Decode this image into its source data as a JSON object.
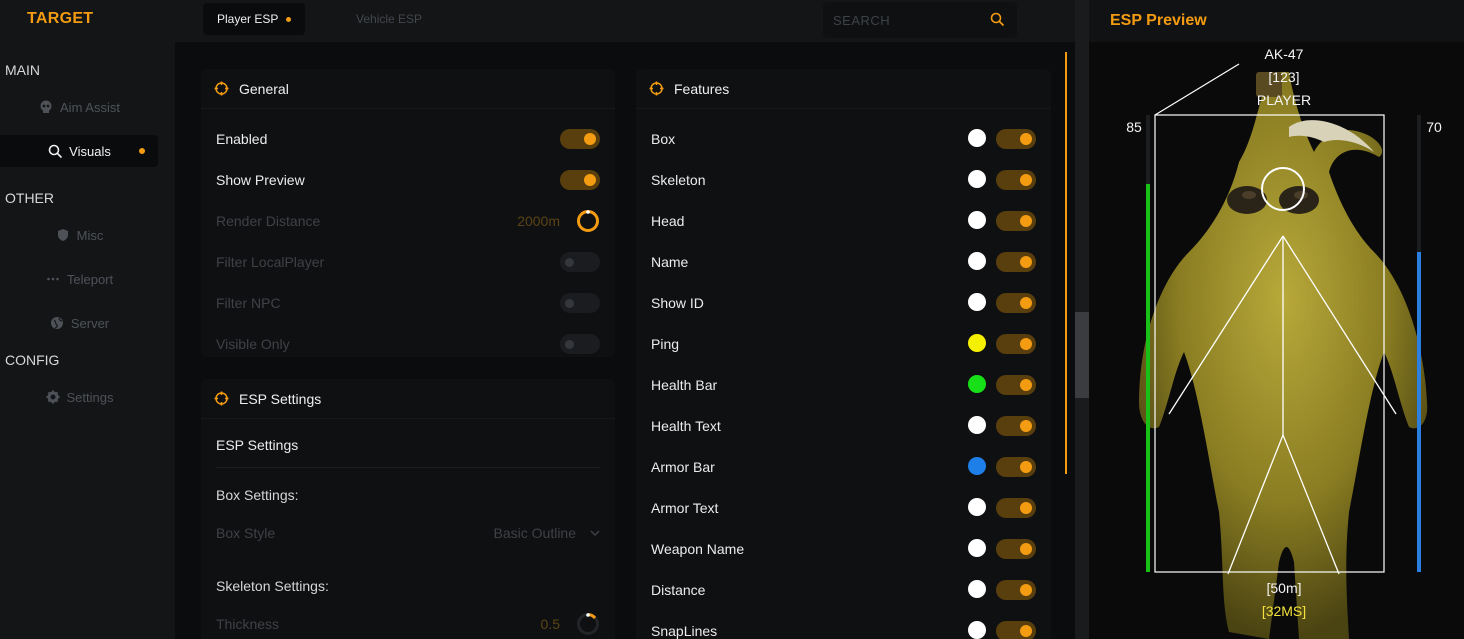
{
  "brand": "TARGET",
  "sidebar": {
    "sections": [
      {
        "title": "MAIN"
      },
      {
        "title": "OTHER"
      },
      {
        "title": "CONFIG"
      }
    ],
    "items": [
      {
        "label": "Aim Assist",
        "icon": "skull-icon"
      },
      {
        "label": "Visuals",
        "icon": "search-icon",
        "active": true
      },
      {
        "label": "Misc",
        "icon": "shield-icon"
      },
      {
        "label": "Teleport",
        "icon": "dots-icon"
      },
      {
        "label": "Server",
        "icon": "globe-icon"
      },
      {
        "label": "Settings",
        "icon": "gear-icon"
      }
    ]
  },
  "tabs": [
    {
      "label": "Player ESP",
      "active": true
    },
    {
      "label": "Vehicle ESP",
      "active": false
    }
  ],
  "search": {
    "placeholder": "SEARCH"
  },
  "general": {
    "title": "General",
    "rows": [
      {
        "label": "Enabled",
        "on": true
      },
      {
        "label": "Show Preview",
        "on": true
      },
      {
        "label": "Render Distance",
        "value": "2000m"
      },
      {
        "label": "Filter LocalPlayer",
        "on": false
      },
      {
        "label": "Filter NPC",
        "on": false
      },
      {
        "label": "Visible Only",
        "on": false
      }
    ]
  },
  "esp_settings": {
    "title": "ESP Settings",
    "subtitle": "ESP Settings",
    "box_settings": "Box Settings:",
    "box_style_label": "Box Style",
    "box_style_value": "Basic Outline",
    "skeleton_settings": "Skeleton Settings:",
    "thickness_label": "Thickness",
    "thickness_value": "0.5"
  },
  "features": {
    "title": "Features",
    "rows": [
      {
        "label": "Box",
        "color": "#ffffff"
      },
      {
        "label": "Skeleton",
        "color": "#ffffff"
      },
      {
        "label": "Head",
        "color": "#ffffff"
      },
      {
        "label": "Name",
        "color": "#ffffff"
      },
      {
        "label": "Show ID",
        "color": "#ffffff"
      },
      {
        "label": "Ping",
        "color": "#f5f000"
      },
      {
        "label": "Health Bar",
        "color": "#18e018"
      },
      {
        "label": "Health Text",
        "color": "#ffffff"
      },
      {
        "label": "Armor Bar",
        "color": "#1f7fe8"
      },
      {
        "label": "Armor Text",
        "color": "#ffffff"
      },
      {
        "label": "Weapon Name",
        "color": "#ffffff"
      },
      {
        "label": "Distance",
        "color": "#ffffff"
      },
      {
        "label": "SnapLines",
        "color": "#ffffff"
      }
    ]
  },
  "preview": {
    "title": "ESP Preview",
    "weapon": "AK-47",
    "id": "[123]",
    "name": "PLAYER",
    "health": "85",
    "health_fraction": 0.85,
    "armor": "70",
    "armor_fraction": 0.7,
    "distance": "[50m]",
    "ping": "[32MS]"
  },
  "colors": {
    "accent": "#f39c12",
    "health": "#18c018",
    "armor": "#2a7fe0"
  }
}
